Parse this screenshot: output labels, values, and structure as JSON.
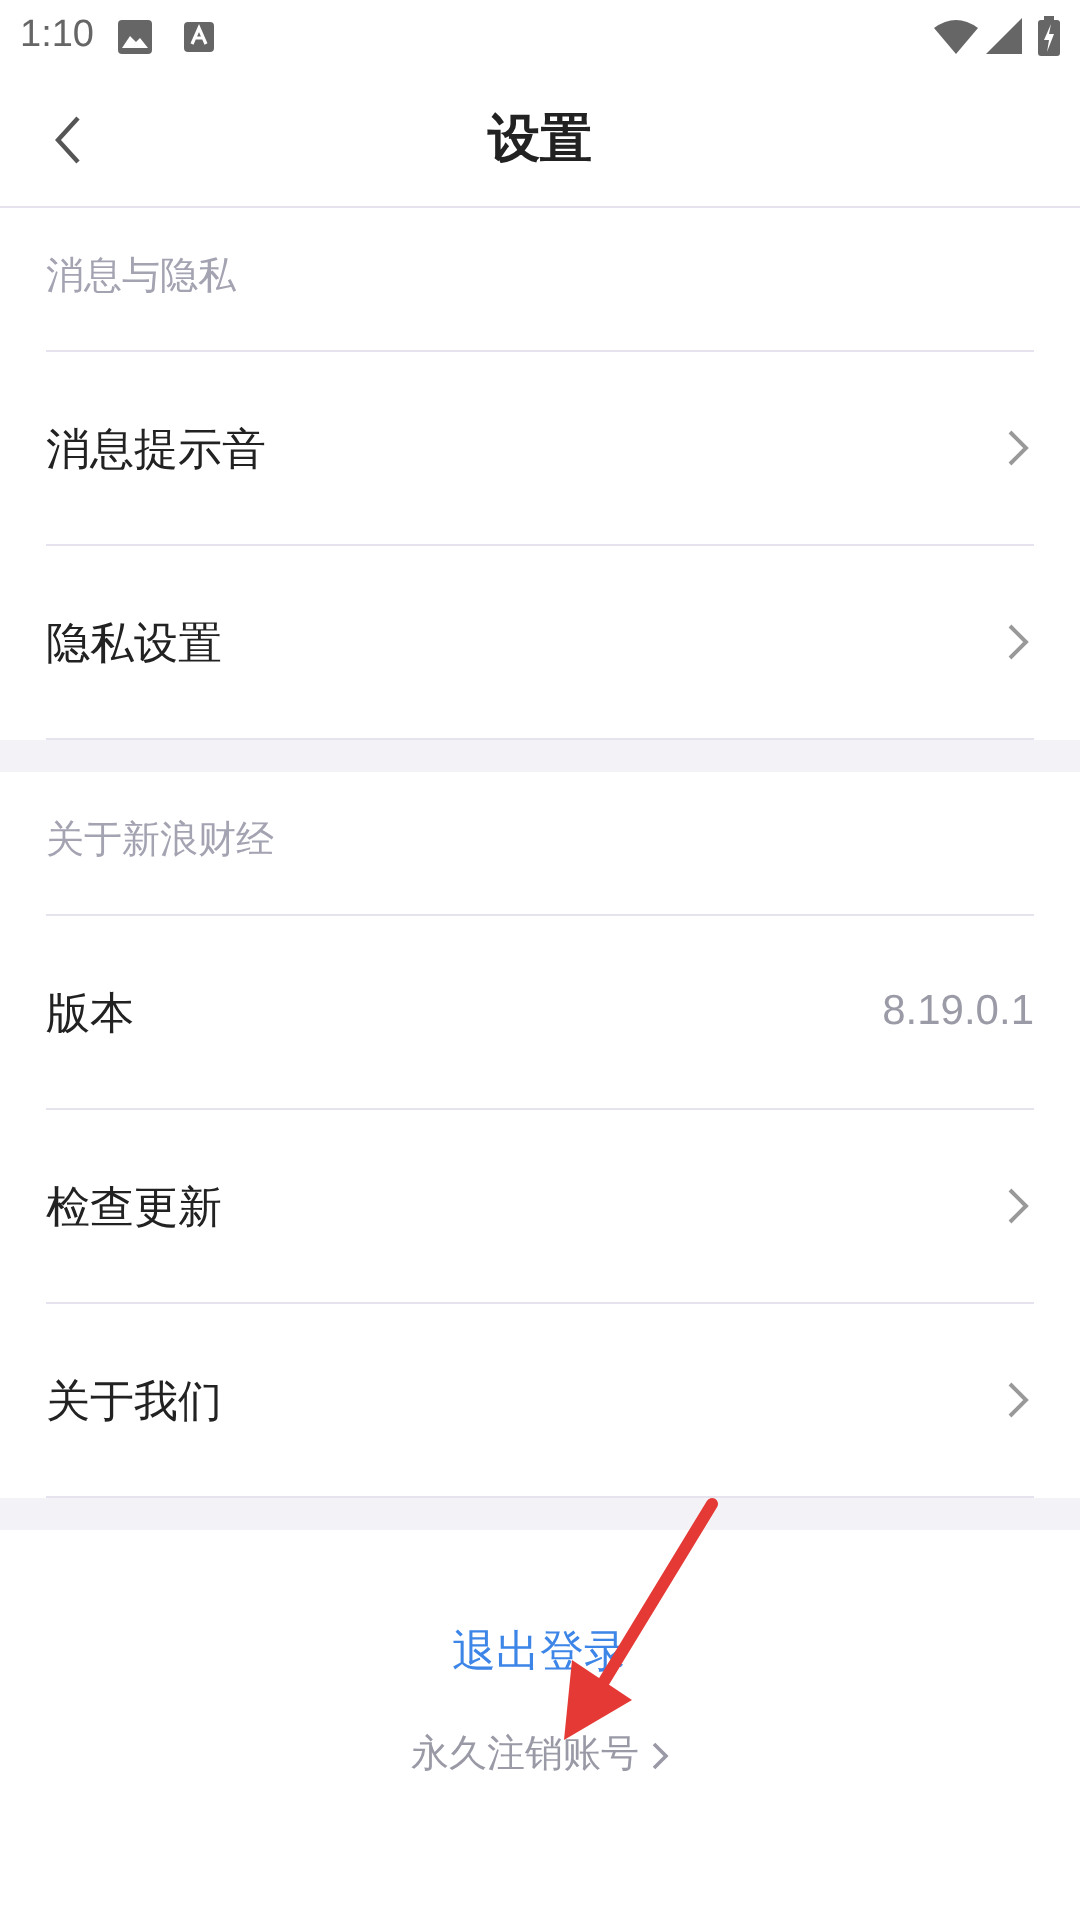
{
  "status_bar": {
    "time": "1:10"
  },
  "header": {
    "title": "设置"
  },
  "sections": [
    {
      "title": "消息与隐私",
      "items": [
        {
          "kind": "link",
          "label": "消息提示音"
        },
        {
          "kind": "link",
          "label": "隐私设置"
        }
      ]
    },
    {
      "title": "关于新浪财经",
      "items": [
        {
          "kind": "value",
          "label": "版本",
          "value": "8.19.0.1"
        },
        {
          "kind": "link",
          "label": "检查更新"
        },
        {
          "kind": "link",
          "label": "关于我们"
        }
      ]
    }
  ],
  "logout": {
    "label": "退出登录"
  },
  "delete_account": {
    "label": "永久注销账号"
  }
}
